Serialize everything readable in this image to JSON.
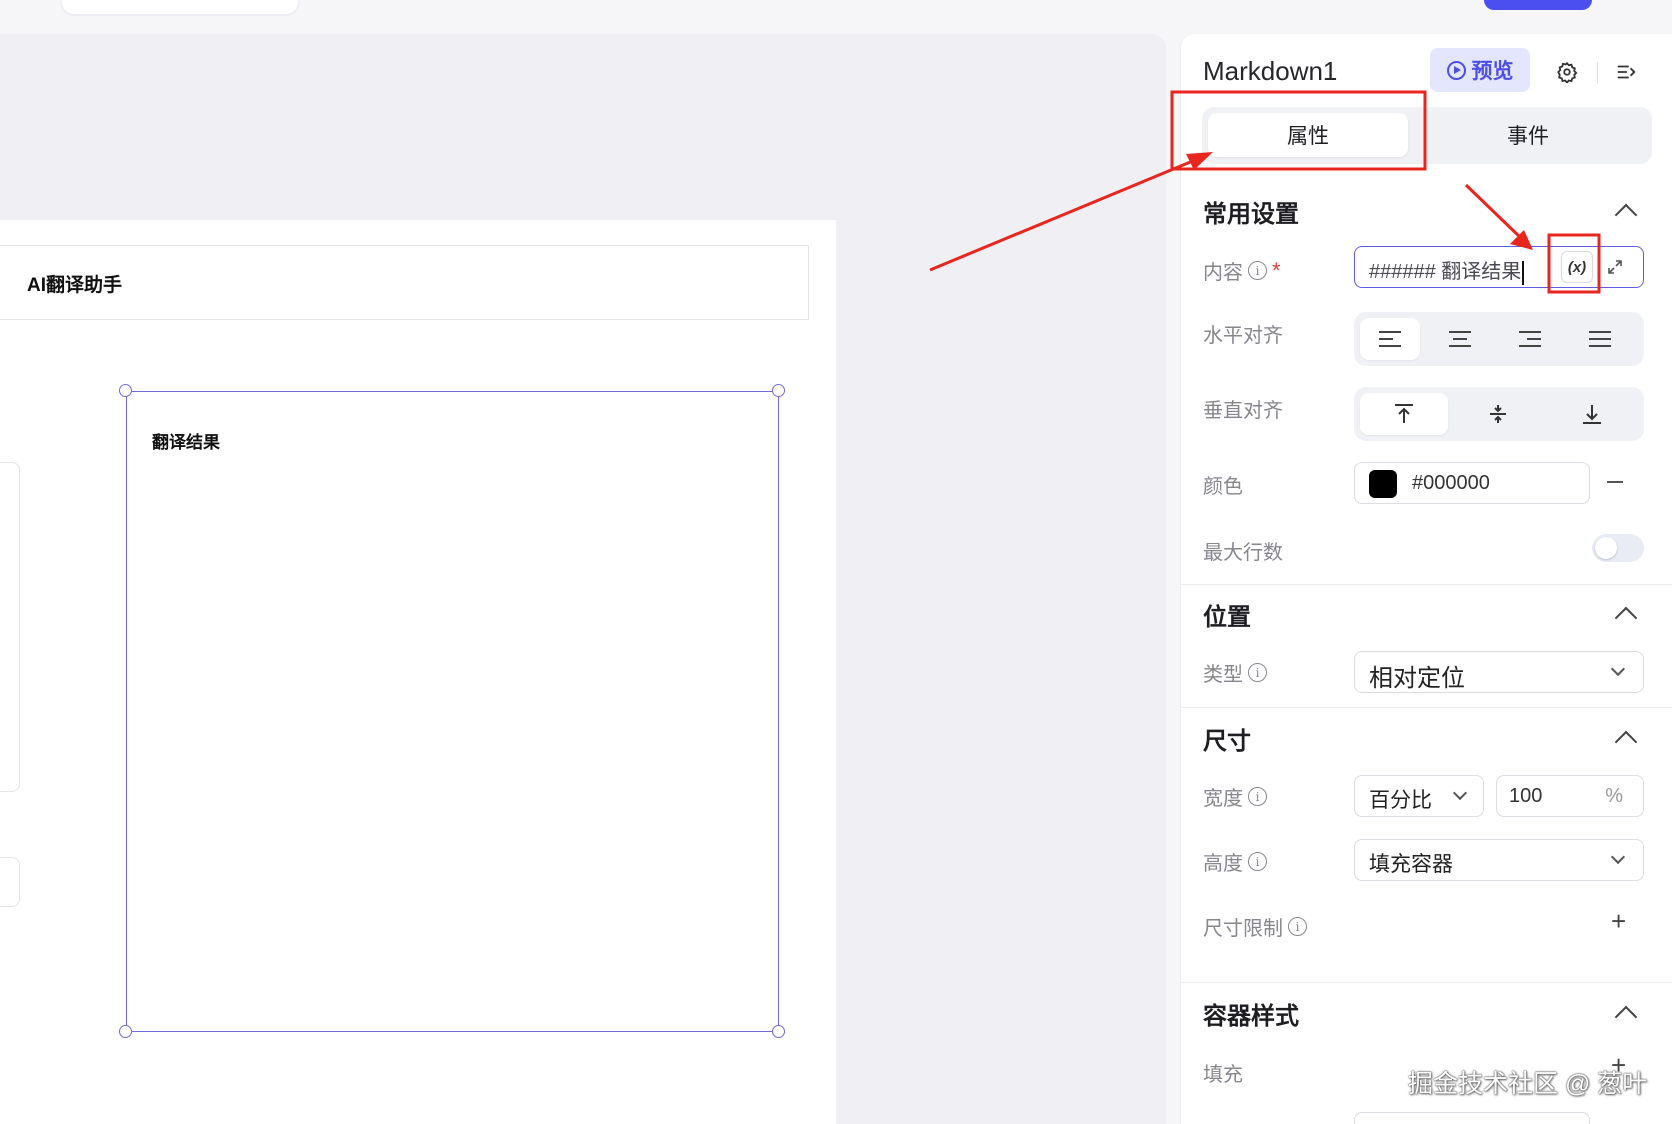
{
  "app": {
    "title": "AI翻译助手"
  },
  "canvas": {
    "markdown_text": "翻译结果"
  },
  "panel": {
    "component_name": "Markdown1",
    "preview_label": "预览",
    "icons": [
      "gear-icon",
      "collapse-panel-icon"
    ],
    "tabs": [
      {
        "label": "属性",
        "active": true
      },
      {
        "label": "事件",
        "active": false
      }
    ],
    "common": {
      "title": "常用设置",
      "content_label": "内容",
      "content_value": "###### 翻译结果",
      "fx_label": "(x)",
      "halign_label": "水平对齐",
      "valign_label": "垂直对齐",
      "color_label": "颜色",
      "color_value": "#000000",
      "max_lines_label": "最大行数",
      "max_lines_enabled": false
    },
    "position": {
      "title": "位置",
      "type_label": "类型",
      "type_value": "相对定位"
    },
    "size": {
      "title": "尺寸",
      "width_label": "宽度",
      "width_mode": "百分比",
      "width_value": "100",
      "width_unit": "%",
      "height_label": "高度",
      "height_value": "填充容器",
      "limit_label": "尺寸限制"
    },
    "container_style": {
      "title": "容器样式",
      "fill_label": "填充"
    }
  },
  "watermark": "掘金技术社区 @ 葱叶",
  "colors": {
    "accent": "#4c4fe6",
    "annotation_red": "#e8251f"
  }
}
